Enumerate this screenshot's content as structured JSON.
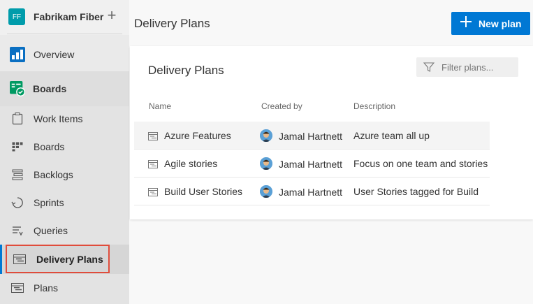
{
  "org": {
    "initials": "FF",
    "name": "Fabrikam Fiber",
    "add_symbol": "+"
  },
  "nav": {
    "overview": "Overview",
    "boards_hub": "Boards",
    "items": [
      {
        "label": "Work Items"
      },
      {
        "label": "Boards"
      },
      {
        "label": "Backlogs"
      },
      {
        "label": "Sprints"
      },
      {
        "label": "Queries"
      },
      {
        "label": "Delivery Plans"
      },
      {
        "label": "Plans"
      }
    ]
  },
  "header": {
    "title": "Delivery Plans",
    "new_plan_label": "New plan"
  },
  "card": {
    "title": "Delivery Plans",
    "filter_placeholder": "Filter plans...",
    "columns": {
      "name": "Name",
      "created_by": "Created by",
      "description": "Description"
    },
    "rows": [
      {
        "name": "Azure  Features",
        "created_by": "Jamal Hartnett",
        "description": "Azure  team all up"
      },
      {
        "name": "Agile stories",
        "created_by": "Jamal Hartnett",
        "description": "Focus on one team and stories"
      },
      {
        "name": "Build User Stories",
        "created_by": "Jamal Hartnett",
        "description": "User Stories tagged for Build"
      }
    ]
  },
  "colors": {
    "accent": "#0078d4",
    "org_avatar": "#009cab",
    "highlight_border": "#e04c3b"
  }
}
